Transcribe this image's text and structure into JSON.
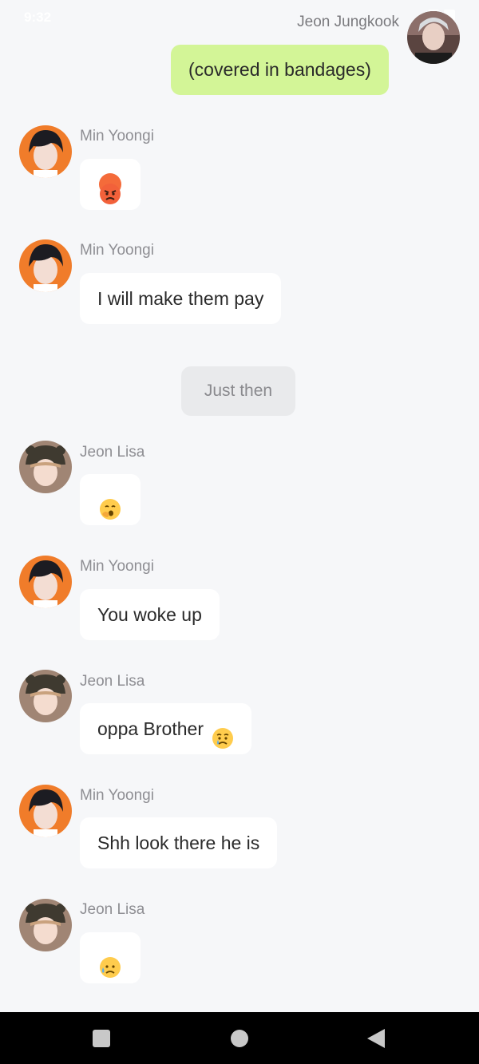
{
  "status_bar": {
    "time": "9:32"
  },
  "messages": [
    {
      "side": "me",
      "sender": "Jeon Jungkook",
      "text": "(covered in bandages)",
      "avatar_icon": "avatar-jeon-jungkook"
    },
    {
      "side": "other",
      "sender": "Min Yoongi",
      "text": "",
      "emoji": "angry-face-emoji",
      "avatar_icon": "avatar-min-yoongi"
    },
    {
      "side": "other",
      "sender": "Min Yoongi",
      "text": "I will make them pay",
      "avatar_icon": "avatar-min-yoongi"
    },
    {
      "side": "narration",
      "text": "Just then"
    },
    {
      "side": "other",
      "sender": "Jeon Lisa",
      "text": "",
      "emoji": "yawning-face-emoji",
      "avatar_icon": "avatar-jeon-lisa"
    },
    {
      "side": "other",
      "sender": "Min Yoongi",
      "text": "You woke up",
      "avatar_icon": "avatar-min-yoongi"
    },
    {
      "side": "other",
      "sender": "Jeon Lisa",
      "text": "oppa Brother",
      "emoji": "crying-face-emoji",
      "avatar_icon": "avatar-jeon-lisa"
    },
    {
      "side": "other",
      "sender": "Min Yoongi",
      "text": "Shh look there he is",
      "avatar_icon": "avatar-min-yoongi"
    },
    {
      "side": "other",
      "sender": "Jeon Lisa",
      "text": "",
      "emoji": "sad-sweat-face-emoji",
      "avatar_icon": "avatar-jeon-lisa"
    }
  ],
  "colors": {
    "background": "#f6f7f9",
    "my_bubble": "#d3f597",
    "other_bubble": "#ffffff",
    "narration_bubble": "#e9eaec",
    "navbar": "#000000"
  },
  "navbar": {
    "recent_icon": "square-icon",
    "home_icon": "circle-icon",
    "back_icon": "triangle-back-icon"
  }
}
